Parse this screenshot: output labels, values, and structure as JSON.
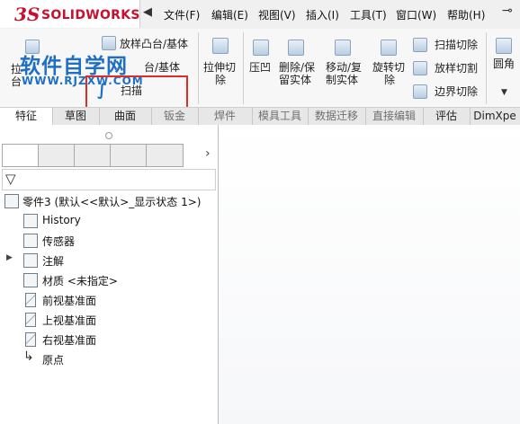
{
  "app": {
    "brand_ds": "3S",
    "brand_name": "SOLIDWORKS"
  },
  "menu": [
    "文件(F)",
    "编辑(E)",
    "视图(V)",
    "插入(I)",
    "工具(T)",
    "窗口(W)",
    "帮助(H)"
  ],
  "ribbon": {
    "extrude_top": "拉",
    "extrude_bot": "台",
    "loft_boss": "放样凸台/基体",
    "boundary_boss": "台/基体",
    "sweep": "扫描",
    "extruded_cut": [
      "拉伸切",
      "除"
    ],
    "hollow": "压凹",
    "delete_body": [
      "删除/保",
      "留实体"
    ],
    "move_body": [
      "移动/复",
      "制实体"
    ],
    "revolved_cut": [
      "旋转切",
      "除"
    ],
    "swept_cut": "扫描切除",
    "lofted_cut": "放样切割",
    "boundary_cut": "边界切除",
    "fillet": "圆角"
  },
  "watermark": {
    "line1": "软件自学网",
    "line2": "WWW.RJZXW.COM"
  },
  "tabs": [
    "特征",
    "草图",
    "曲面",
    "钣金",
    "焊件",
    "模具工具",
    "数据迁移",
    "直接编辑",
    "评估",
    "DimXpe"
  ],
  "tree": {
    "root": "零件3 (默认<<默认>_显示状态 1>)",
    "items": [
      "History",
      "传感器",
      "注解",
      "材质 <未指定>",
      "前视基准面",
      "上视基准面",
      "右视基准面",
      "原点"
    ]
  },
  "colors": {
    "brand_red": "#c8102e",
    "watermark_blue": "#1f6fc4",
    "highlight_red": "#e02b2b"
  }
}
